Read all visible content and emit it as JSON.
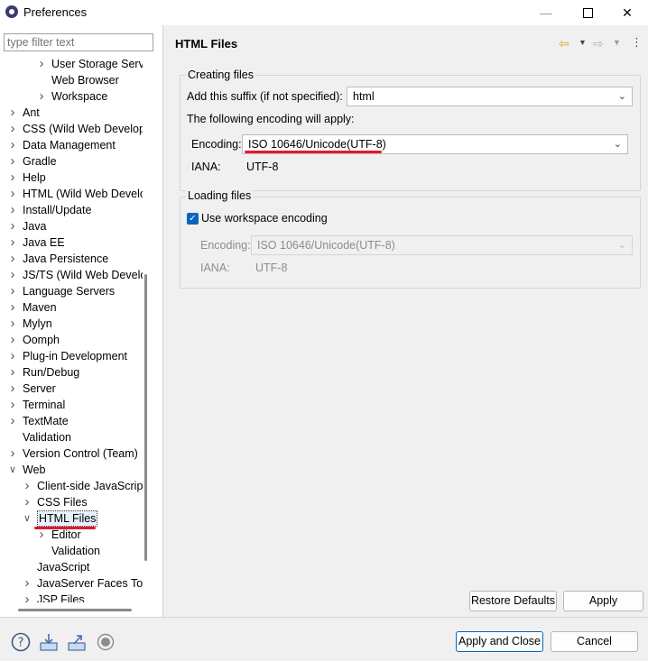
{
  "window": {
    "title": "Preferences"
  },
  "sidebar": {
    "filter_placeholder": "type filter text",
    "items": [
      {
        "label": "User Storage Service",
        "chev": "right",
        "level": 2
      },
      {
        "label": "Web Browser",
        "chev": "none",
        "level": 2
      },
      {
        "label": "Workspace",
        "chev": "right",
        "level": 2
      },
      {
        "label": "Ant",
        "chev": "right",
        "level": 0
      },
      {
        "label": "CSS (Wild Web Develop",
        "chev": "right",
        "level": 0
      },
      {
        "label": "Data Management",
        "chev": "right",
        "level": 0
      },
      {
        "label": "Gradle",
        "chev": "right",
        "level": 0
      },
      {
        "label": "Help",
        "chev": "right",
        "level": 0
      },
      {
        "label": "HTML (Wild Web Develo",
        "chev": "right",
        "level": 0
      },
      {
        "label": "Install/Update",
        "chev": "right",
        "level": 0
      },
      {
        "label": "Java",
        "chev": "right",
        "level": 0
      },
      {
        "label": "Java EE",
        "chev": "right",
        "level": 0
      },
      {
        "label": "Java Persistence",
        "chev": "right",
        "level": 0
      },
      {
        "label": "JS/TS (Wild Web Develo",
        "chev": "right",
        "level": 0
      },
      {
        "label": "Language Servers",
        "chev": "right",
        "level": 0
      },
      {
        "label": "Maven",
        "chev": "right",
        "level": 0
      },
      {
        "label": "Mylyn",
        "chev": "right",
        "level": 0
      },
      {
        "label": "Oomph",
        "chev": "right",
        "level": 0
      },
      {
        "label": "Plug-in Development",
        "chev": "right",
        "level": 0
      },
      {
        "label": "Run/Debug",
        "chev": "right",
        "level": 0
      },
      {
        "label": "Server",
        "chev": "right",
        "level": 0
      },
      {
        "label": "Terminal",
        "chev": "right",
        "level": 0
      },
      {
        "label": "TextMate",
        "chev": "right",
        "level": 0
      },
      {
        "label": "Validation",
        "chev": "none",
        "level": 0
      },
      {
        "label": "Version Control (Team)",
        "chev": "right",
        "level": 0
      },
      {
        "label": "Web",
        "chev": "down",
        "level": 0
      },
      {
        "label": "Client-side JavaScript",
        "chev": "right",
        "level": 1
      },
      {
        "label": "CSS Files",
        "chev": "right",
        "level": 1
      },
      {
        "label": "HTML Files",
        "chev": "down",
        "level": 1,
        "selected": true
      },
      {
        "label": "Editor",
        "chev": "right",
        "level": 2
      },
      {
        "label": "Validation",
        "chev": "none",
        "level": 2
      },
      {
        "label": "JavaScript",
        "chev": "none",
        "level": 1
      },
      {
        "label": "JavaServer Faces Too",
        "chev": "right",
        "level": 1
      },
      {
        "label": "JSP Files",
        "chev": "right",
        "level": 1
      }
    ]
  },
  "page": {
    "title": "HTML Files",
    "creating": {
      "legend": "Creating files",
      "suffix_label": "Add this suffix (if not specified):",
      "suffix_value": "html",
      "encoding_note": "The following encoding will apply:",
      "encoding_label": "Encoding:",
      "encoding_value": "ISO 10646/Unicode(UTF-8)",
      "iana_label": "IANA:",
      "iana_value": "UTF-8"
    },
    "loading": {
      "legend": "Loading files",
      "checkbox_label": "Use workspace encoding",
      "checked": true,
      "encoding_label": "Encoding:",
      "encoding_value": "ISO 10646/Unicode(UTF-8)",
      "iana_label": "IANA:",
      "iana_value": "UTF-8"
    },
    "restore_defaults": "Restore Defaults",
    "apply": "Apply"
  },
  "footer": {
    "apply_close": "Apply and Close",
    "cancel": "Cancel",
    "icons": [
      "help-icon",
      "import-icon",
      "export-icon",
      "record-icon"
    ]
  },
  "colors": {
    "accent": "#0a64c2",
    "highlight": "#e0192e"
  }
}
